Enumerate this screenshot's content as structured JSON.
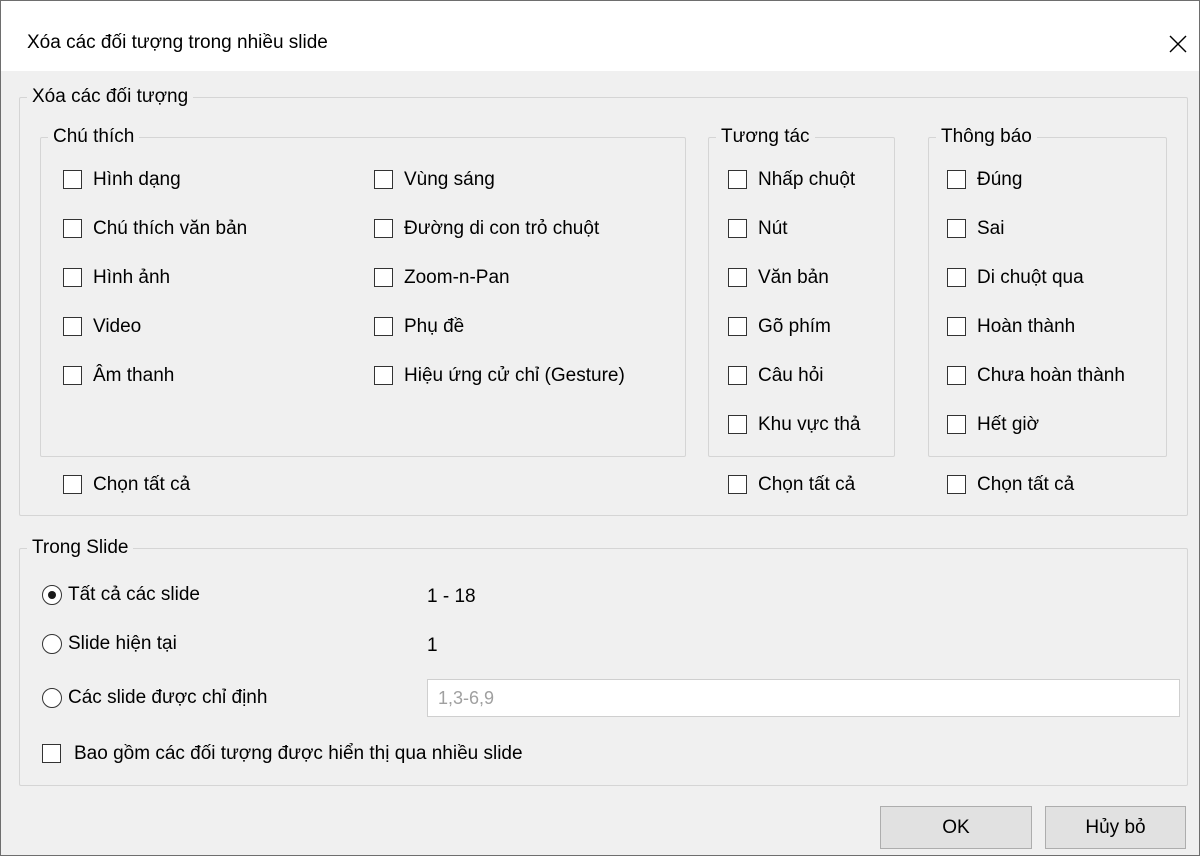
{
  "dialog": {
    "title": "Xóa các đối tượng trong nhiều slide"
  },
  "remove_objects": {
    "legend": "Xóa các đối tượng",
    "annotations": {
      "legend": "Chú thích",
      "left_items": [
        {
          "label": "Hình dạng",
          "checked": false
        },
        {
          "label": "Chú thích văn bản",
          "checked": false
        },
        {
          "label": "Hình ảnh",
          "checked": false
        },
        {
          "label": "Video",
          "checked": false
        },
        {
          "label": "Âm thanh",
          "checked": false
        }
      ],
      "right_items": [
        {
          "label": "Vùng sáng",
          "checked": false
        },
        {
          "label": "Đường di con trỏ chuột",
          "checked": false
        },
        {
          "label": "Zoom-n-Pan",
          "checked": false
        },
        {
          "label": "Phụ đề",
          "checked": false
        },
        {
          "label": "Hiệu ứng cử chỉ (Gesture)",
          "checked": false
        }
      ],
      "select_all_label": "Chọn tất cả"
    },
    "interactions": {
      "legend": "Tương tác",
      "items": [
        {
          "label": "Nhấp chuột",
          "checked": false
        },
        {
          "label": "Nút",
          "checked": false
        },
        {
          "label": "Văn bản",
          "checked": false
        },
        {
          "label": "Gõ phím",
          "checked": false
        },
        {
          "label": "Câu hỏi",
          "checked": false
        },
        {
          "label": "Khu vực thả",
          "checked": false
        }
      ],
      "select_all_label": "Chọn tất cả"
    },
    "messages": {
      "legend": "Thông báo",
      "items": [
        {
          "label": "Đúng",
          "checked": false
        },
        {
          "label": "Sai",
          "checked": false
        },
        {
          "label": "Di chuột qua",
          "checked": false
        },
        {
          "label": "Hoàn thành",
          "checked": false
        },
        {
          "label": "Chưa hoàn thành",
          "checked": false
        },
        {
          "label": "Hết giờ",
          "checked": false
        }
      ],
      "select_all_label": "Chọn tất cả"
    }
  },
  "slides": {
    "legend": "Trong Slide",
    "options": [
      {
        "label": "Tất cả các slide",
        "value": "1 - 18",
        "selected": true
      },
      {
        "label": "Slide hiện tại",
        "value": "1",
        "selected": false
      },
      {
        "label": "Các slide được chỉ định",
        "value": "",
        "selected": false
      }
    ],
    "specified_placeholder": "1,3-6,9",
    "include_label": "Bao gồm các đối tượng được hiển thị qua nhiều slide",
    "include_checked": false
  },
  "buttons": {
    "ok": "OK",
    "cancel": "Hủy bỏ"
  }
}
